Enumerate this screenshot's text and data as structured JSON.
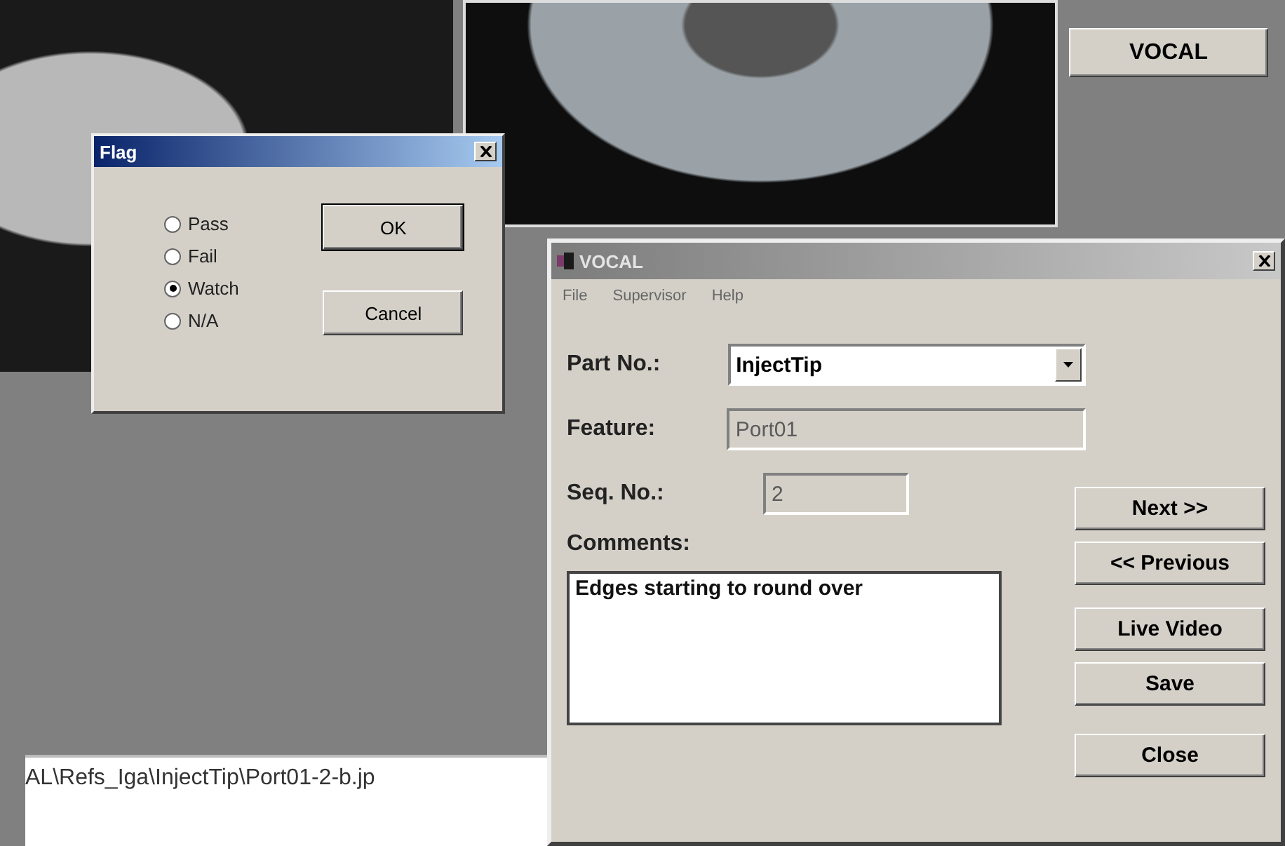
{
  "top_button": {
    "label": "VOCAL"
  },
  "file_path": "AL\\Refs_Iga\\InjectTip\\Port01-2-b.jp",
  "flag_dialog": {
    "title": "Flag",
    "options": [
      {
        "label": "Pass",
        "selected": false
      },
      {
        "label": "Fail",
        "selected": false
      },
      {
        "label": "Watch",
        "selected": true
      },
      {
        "label": "N/A",
        "selected": false
      }
    ],
    "buttons": [
      "OK",
      "Cancel"
    ]
  },
  "main_window": {
    "title": "VOCAL",
    "menu": [
      {
        "label": "File",
        "disabled": true
      },
      {
        "label": "Supervisor",
        "disabled": true
      },
      {
        "label": "Help",
        "disabled": true
      }
    ],
    "fields": [
      {
        "kind": "dropdown",
        "label": "Part No.:",
        "value": "InjectTip",
        "disabled": false
      },
      {
        "kind": "text",
        "label": "Feature:",
        "value": "Port01",
        "disabled": true
      },
      {
        "kind": "short",
        "label": "Seq. No.:",
        "value": "2",
        "disabled": true
      }
    ],
    "comments": {
      "label": "Comments:",
      "value": "Edges starting to round over"
    },
    "buttons": [
      "Next >>",
      "<< Previous",
      "Live Video",
      "Save",
      "Close"
    ]
  }
}
